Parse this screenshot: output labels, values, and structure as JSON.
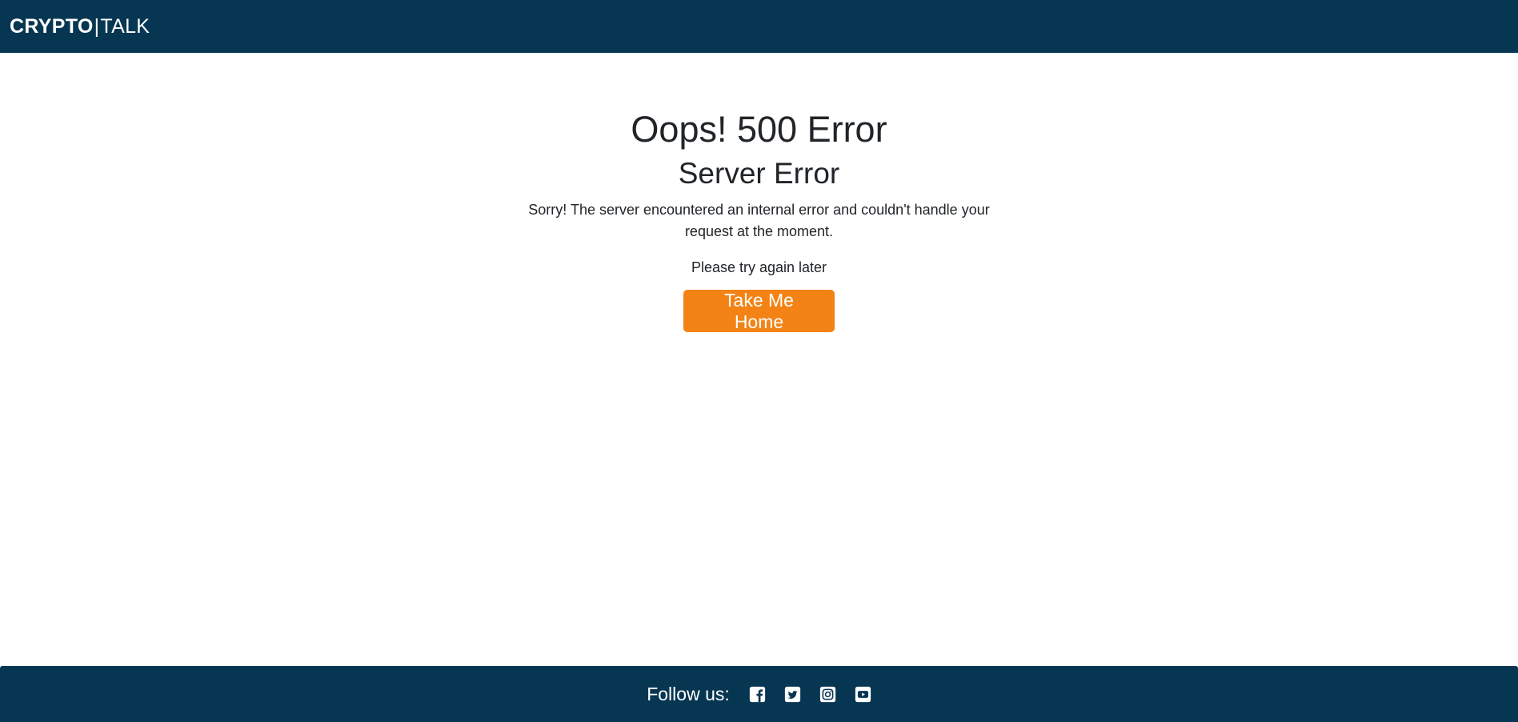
{
  "navbar": {
    "brand_bold": "CRYPTO",
    "brand_sep": "|",
    "brand_light": "TALK"
  },
  "main": {
    "title": "Oops! 500 Error",
    "subtitle": "Server Error",
    "message": "Sorry! The server encountered an internal error and couldn't handle your request at the moment.",
    "retry_text": "Please try again later",
    "home_button_label": "Take Me Home"
  },
  "footer": {
    "follow_label": "Follow us:",
    "social_icons": [
      "facebook-icon",
      "twitter-icon",
      "instagram-icon",
      "youtube-icon"
    ]
  },
  "colors": {
    "navbar_bg": "#073652",
    "accent_button": "#f28314",
    "text": "#212529"
  }
}
